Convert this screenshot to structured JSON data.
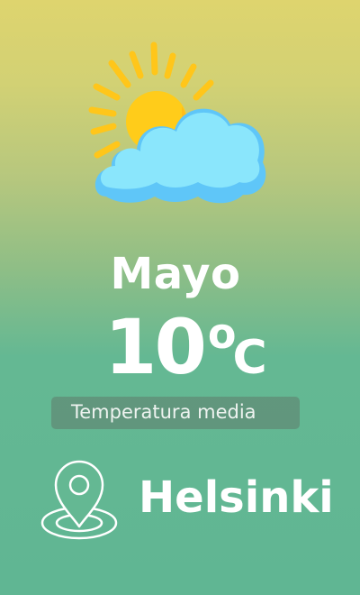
{
  "weather": {
    "icon": "sun-behind-cloud-icon",
    "month": "Mayo",
    "temperature": "10",
    "degree_symbol": "o",
    "unit": "C",
    "caption": "Temperatura media"
  },
  "location": {
    "icon": "location-pin-icon",
    "city": "Helsinki"
  },
  "colors": {
    "background_top": "#ded46e",
    "background_bottom": "#60b693",
    "sun": "#ffcc1a",
    "cloud": "#88e4fb",
    "text": "#ffffff"
  }
}
